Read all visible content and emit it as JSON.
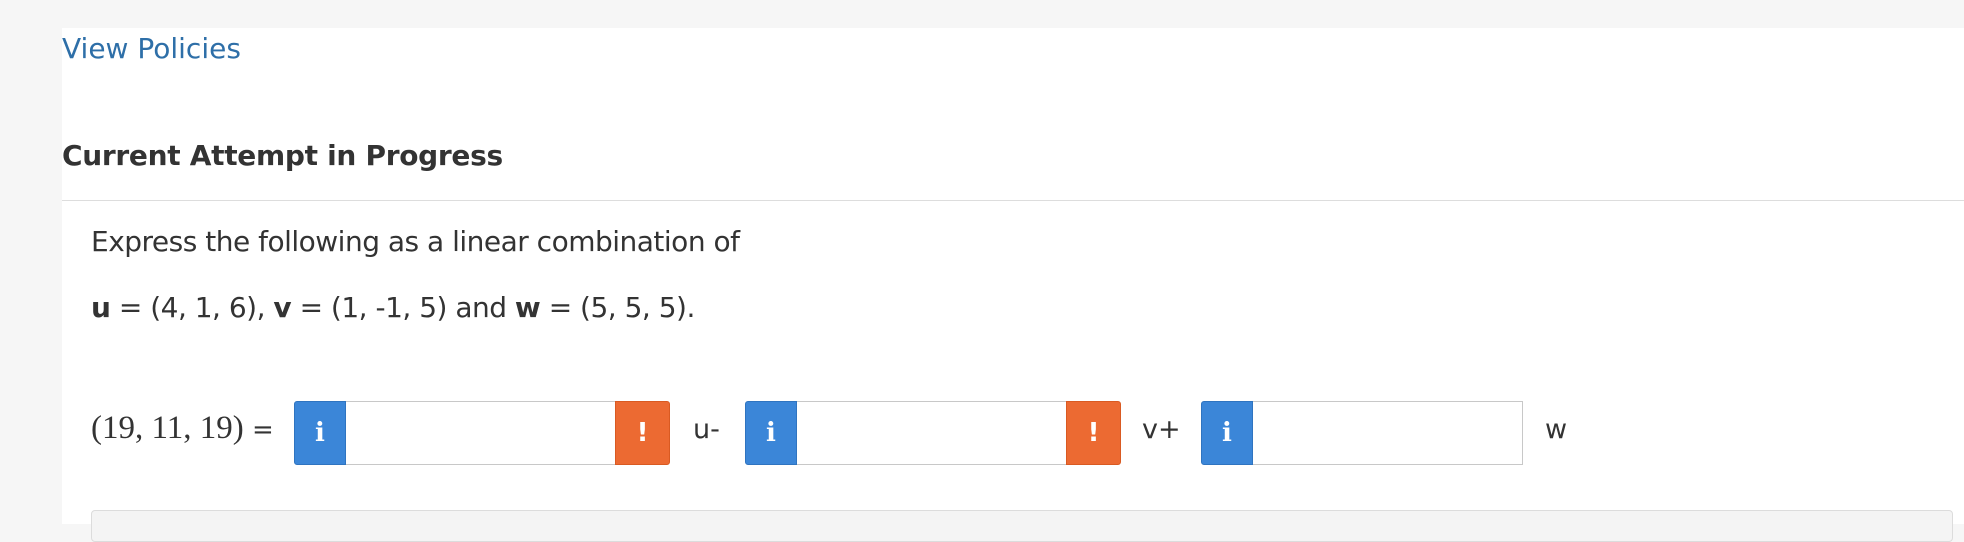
{
  "links": {
    "view_policies": "View Policies"
  },
  "attempt": {
    "title": "Current Attempt in Progress"
  },
  "question": {
    "line1": "Express the following as a linear combination of",
    "line2": {
      "u_name": "u",
      "u_value": " = (4, 1, 6), ",
      "v_name": "v",
      "v_value": " = (1, -1, 5) and ",
      "w_name": "w",
      "w_value": " = (5, 5, 5)."
    }
  },
  "equation": {
    "lhs": "(19, 11, 19)",
    "equals": " =",
    "info_glyph": "i",
    "warning_glyph": "!",
    "inputs": [
      {
        "value": "",
        "placeholder": ""
      },
      {
        "value": "",
        "placeholder": ""
      },
      {
        "value": "",
        "placeholder": ""
      }
    ],
    "labels": [
      "u-",
      "v+",
      "w"
    ]
  },
  "colors": {
    "link": "#2e6fa8",
    "info_button": "#3b86d8",
    "warning_button": "#ec6a32",
    "text": "#333333"
  },
  "icons": {
    "info": "info-icon",
    "warning": "exclamation-icon"
  }
}
